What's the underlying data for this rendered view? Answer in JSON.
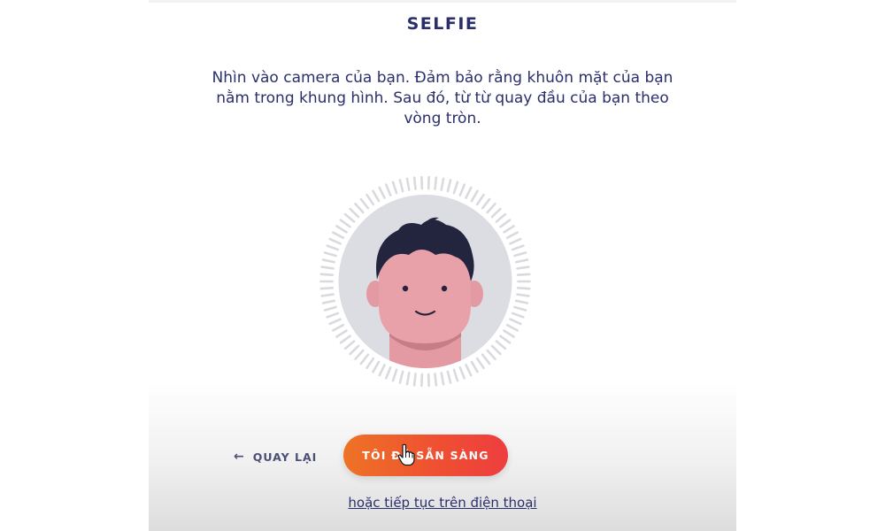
{
  "title": "SELFIE",
  "instructions": "Nhìn vào camera của bạn. Đảm bảo rằng khuôn mặt của bạn nằm trong khung hình. Sau đó, từ từ quay đầu của bạn theo vòng tròn.",
  "back_button": {
    "icon": "arrow-left-icon",
    "label": "QUAY LẠI"
  },
  "ready_button": {
    "label": "TÔI ĐÃ SẴN SÀNG"
  },
  "phone_link": "hoặc tiếp tục trên điện thoại",
  "colors": {
    "title": "#2a2f6b",
    "button_start": "#ee7325",
    "button_end": "#ee3d3f",
    "skin": "#e8a1a8",
    "hair": "#23253f",
    "circle_bg": "#dcdde2"
  }
}
